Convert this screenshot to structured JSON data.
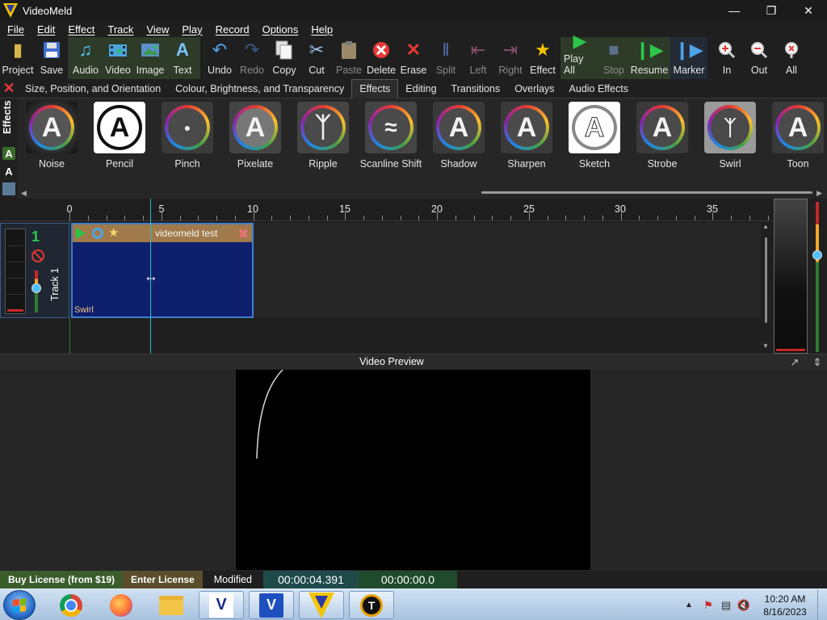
{
  "window": {
    "title": "VideoMeld",
    "controls": {
      "minimize": "—",
      "maximize": "❐",
      "close": "✕"
    }
  },
  "menu": [
    "File",
    "Edit",
    "Effect",
    "Track",
    "View",
    "Play",
    "Record",
    "Options",
    "Help"
  ],
  "toolbar": {
    "project": "Project",
    "save": "Save",
    "audio": "Audio",
    "video": "Video",
    "image": "Image",
    "text": "Text",
    "undo": "Undo",
    "redo": "Redo",
    "copy": "Copy",
    "cut": "Cut",
    "paste": "Paste",
    "delete": "Delete",
    "erase": "Erase",
    "split": "Split",
    "left": "Left",
    "right": "Right",
    "effect": "Effect",
    "play_all": "Play All",
    "stop": "Stop",
    "resume": "Resume",
    "marker": "Marker",
    "zoom_in": "In",
    "zoom_out": "Out",
    "zoom_all": "All"
  },
  "tabs": [
    "Size, Position, and Orientation",
    "Colour, Brightness, and Transparency",
    "Effects",
    "Editing",
    "Transitions",
    "Overlays",
    "Audio Effects"
  ],
  "active_tab": "Effects",
  "effects_panel": {
    "side_label": "Effects",
    "items": [
      "Noise",
      "Pencil",
      "Pinch",
      "Pixelate",
      "Ripple",
      "Scanline Shift",
      "Shadow",
      "Sharpen",
      "Sketch",
      "Strobe",
      "Swirl",
      "Toon"
    ]
  },
  "timeline": {
    "ruler_labels": [
      "0",
      "5",
      "10",
      "15",
      "20",
      "25",
      "30",
      "35"
    ],
    "track": {
      "number": "1",
      "name": "Track 1"
    },
    "clip": {
      "title": "videomeld test",
      "effect": "Swirl"
    }
  },
  "preview": {
    "title": "Video Preview"
  },
  "status": {
    "buy": "Buy License (from $19)",
    "enter": "Enter License",
    "modified": "Modified",
    "position": "00:00:04.391",
    "selection": "00:00:00.0"
  },
  "taskbar": {
    "time": "10:20 AM",
    "date": "8/16/2023"
  }
}
